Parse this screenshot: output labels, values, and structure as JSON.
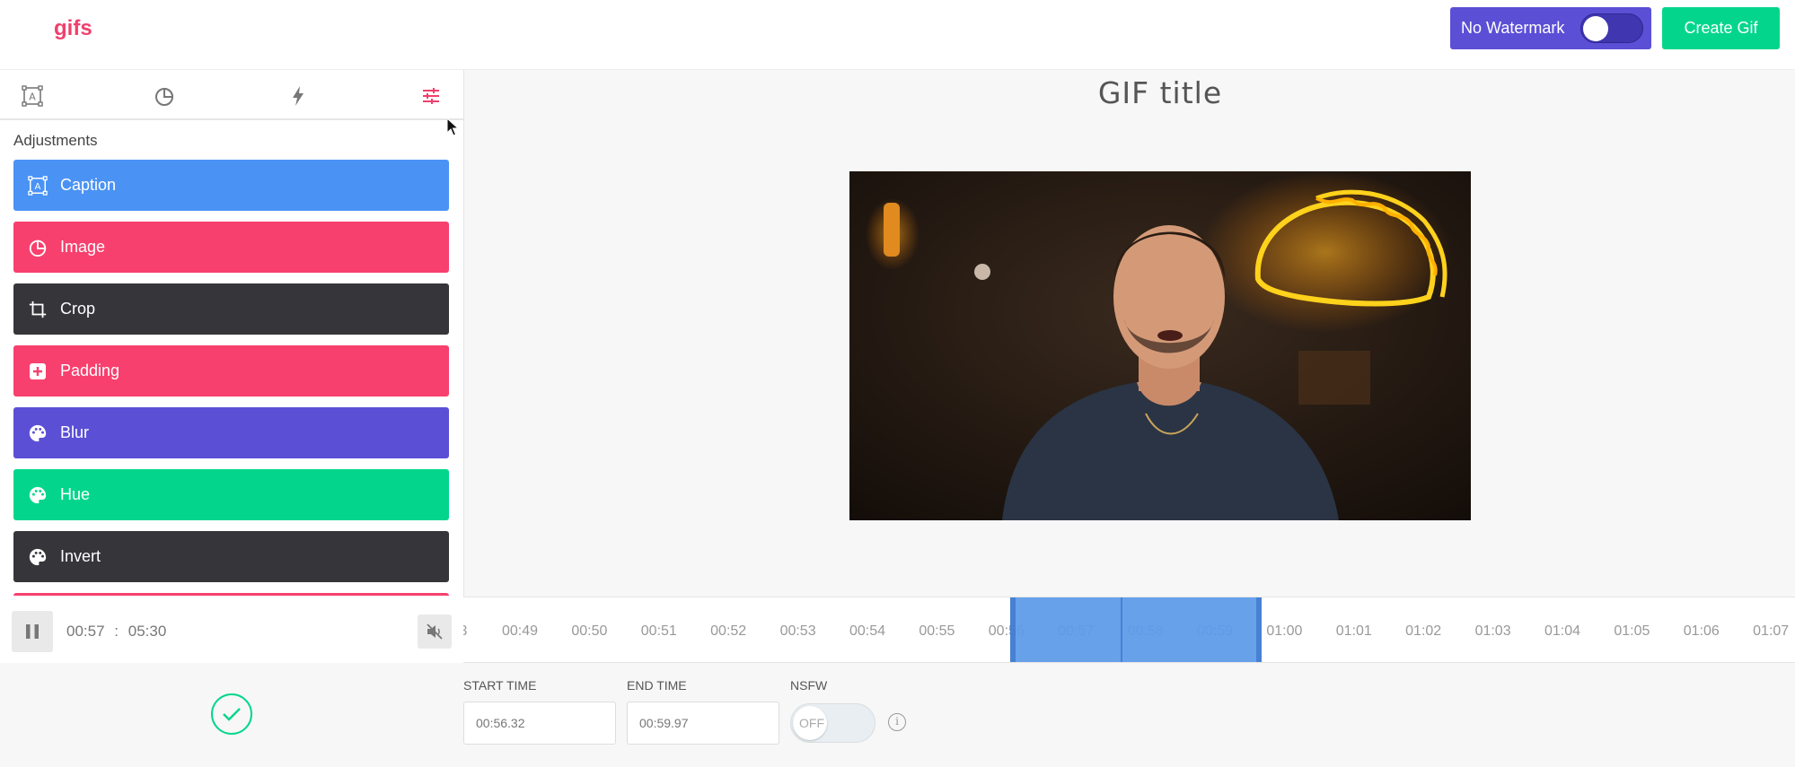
{
  "app": {
    "logo": "gifs"
  },
  "header": {
    "watermark_label": "No Watermark",
    "create_label": "Create Gif"
  },
  "sidebar": {
    "tabs": [
      "caption-tab",
      "image-tab",
      "effects-tab",
      "adjustments-tab"
    ],
    "section_title": "Adjustments",
    "items": [
      {
        "label": "Caption",
        "color": "#4a93f5",
        "icon": "caption-icon"
      },
      {
        "label": "Image",
        "color": "#f7406e",
        "icon": "pie-icon"
      },
      {
        "label": "Crop",
        "color": "#35353a",
        "icon": "crop-icon"
      },
      {
        "label": "Padding",
        "color": "#f7406e",
        "icon": "plus-square-icon"
      },
      {
        "label": "Blur",
        "color": "#5b4fd6",
        "icon": "palette-icon"
      },
      {
        "label": "Hue",
        "color": "#03d68c",
        "icon": "palette-icon"
      },
      {
        "label": "Invert",
        "color": "#35353a",
        "icon": "palette-icon"
      }
    ]
  },
  "stage": {
    "gif_title": "GIF title"
  },
  "player": {
    "current": "00:57",
    "separator": ":",
    "duration": "05:30"
  },
  "timeline": {
    "ticks": [
      "3",
      "00:49",
      "00:50",
      "00:51",
      "00:52",
      "00:53",
      "00:54",
      "00:55",
      "00:56",
      "00:57",
      "00:58",
      "00:59",
      "01:00",
      "01:01",
      "01:02",
      "01:03",
      "01:04",
      "01:05",
      "01:06",
      "01:07"
    ]
  },
  "form": {
    "start_label": "START TIME",
    "start_value": "00:56.32",
    "end_label": "END TIME",
    "end_value": "00:59.97",
    "nsfw_label": "NSFW",
    "nsfw_state": "OFF",
    "info_symbol": "i"
  }
}
